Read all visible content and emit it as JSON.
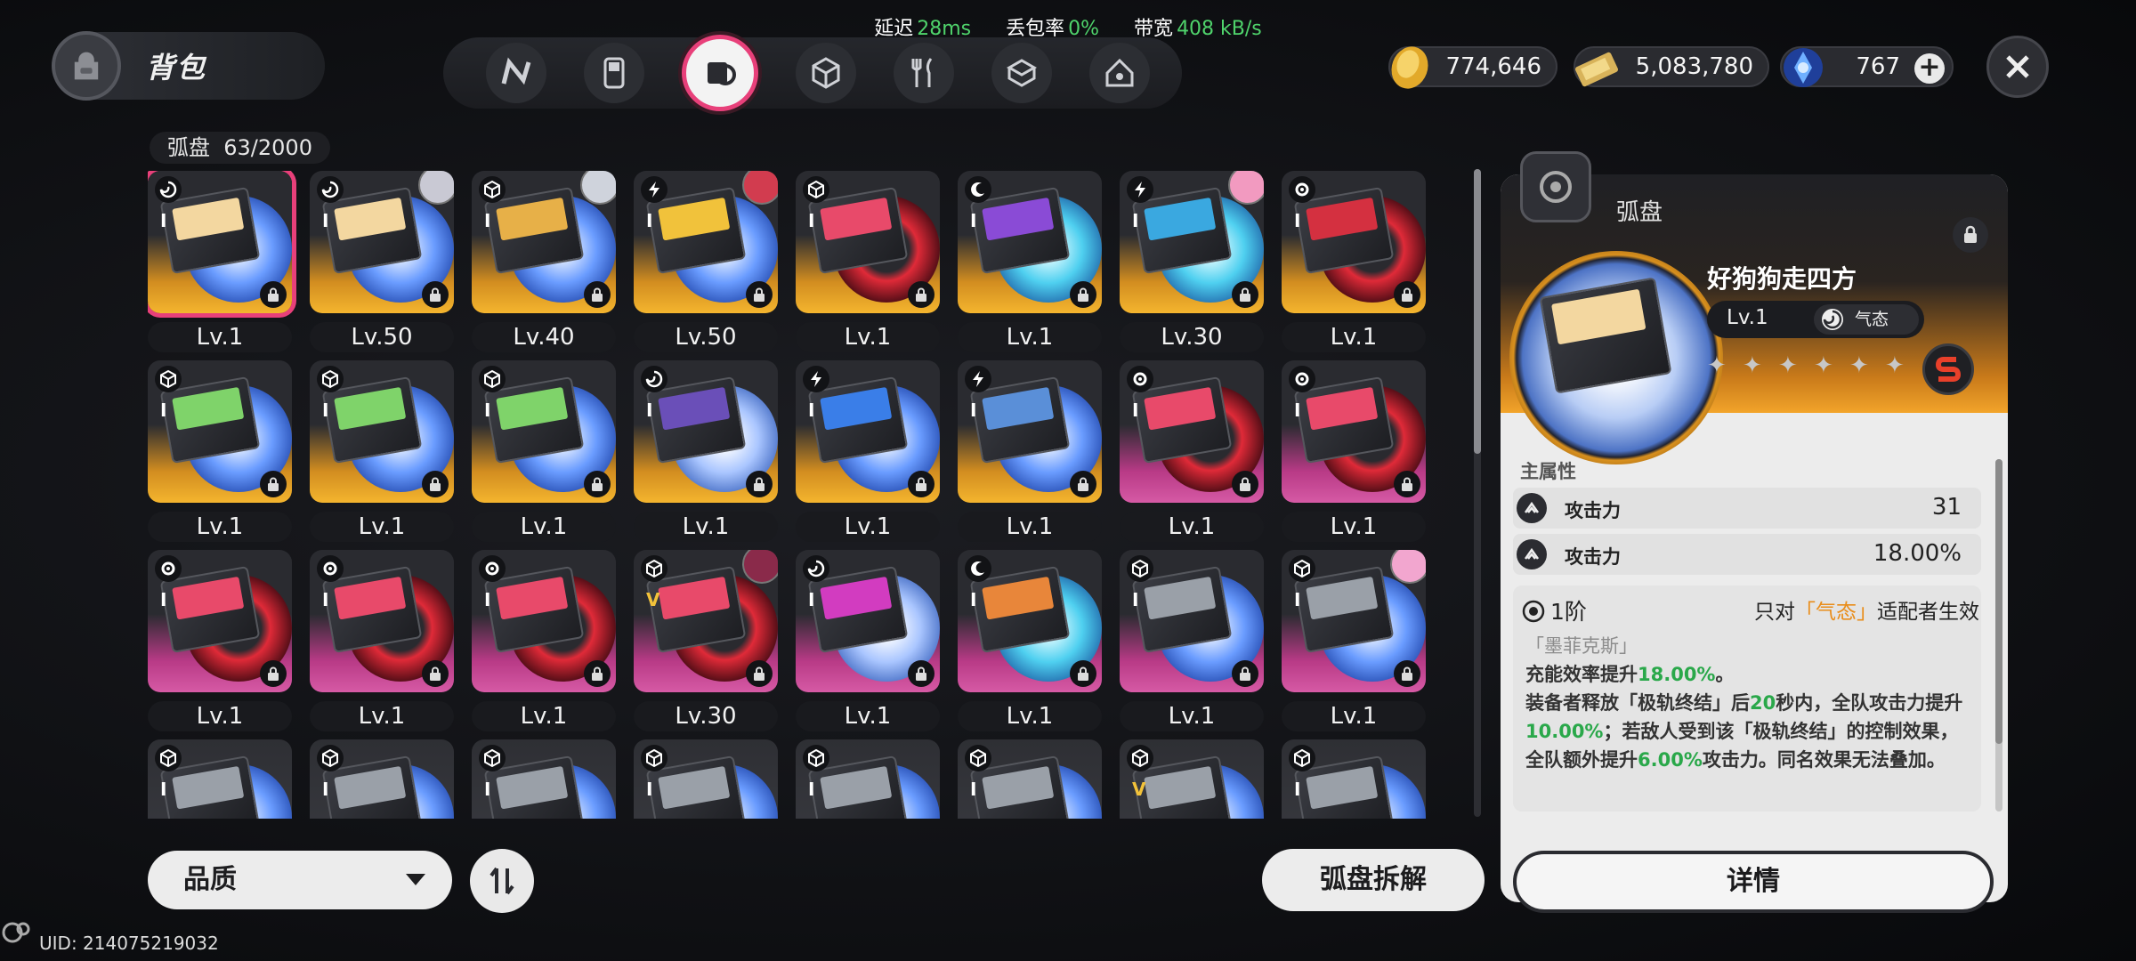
{
  "net": {
    "latency_label": "延迟",
    "latency_value": "28ms",
    "loss_label": "丢包率",
    "loss_value": "0%",
    "bw_label": "带宽",
    "bw_value": "408 kB/s"
  },
  "header": {
    "title": "背包"
  },
  "category_tabs": [
    "n-logo-icon",
    "handheld-icon",
    "disc-icon",
    "cube-icon",
    "fork-knife-icon",
    "package-icon",
    "home-icon"
  ],
  "active_category": 2,
  "currency": {
    "gold": "774,646",
    "ticket": "5,083,780",
    "crystal": "767"
  },
  "list": {
    "title": "弧盘",
    "count": "63/2000"
  },
  "grid": [
    {
      "level": "Lv.1",
      "rank": "I",
      "frame": "gold",
      "disc": "blue",
      "label_color": "#f3d7a0",
      "element": "swirl",
      "selected": true
    },
    {
      "level": "Lv.50",
      "rank": "I",
      "frame": "gold",
      "disc": "blue",
      "label_color": "#f3d7a0",
      "element": "swirl",
      "avatar": "#c9c9d4"
    },
    {
      "level": "Lv.40",
      "rank": "I",
      "frame": "gold",
      "disc": "blue",
      "label_color": "#e7b048",
      "element": "cube",
      "avatar": "#cfd3dc"
    },
    {
      "level": "Lv.50",
      "rank": "I",
      "frame": "gold",
      "disc": "blue",
      "label_color": "#f1c23b",
      "element": "bolt",
      "avatar": "#d23c4f"
    },
    {
      "level": "Lv.1",
      "rank": "I",
      "frame": "gold",
      "disc": "red",
      "label_color": "#e84a6a",
      "element": "cube"
    },
    {
      "level": "Lv.1",
      "rank": "I",
      "frame": "gold",
      "disc": "cyan",
      "label_color": "#8a4bd6",
      "element": "moon"
    },
    {
      "level": "Lv.30",
      "rank": "I",
      "frame": "gold",
      "disc": "cyan",
      "label_color": "#3aa8e0",
      "element": "bolt",
      "avatar": "#f29ac0"
    },
    {
      "level": "Lv.1",
      "rank": "I",
      "frame": "gold",
      "disc": "red",
      "label_color": "#d43040",
      "element": "gear"
    },
    {
      "level": "Lv.1",
      "rank": "I",
      "frame": "gold",
      "disc": "blue",
      "label_color": "#7fd36a",
      "element": "cube"
    },
    {
      "level": "Lv.1",
      "rank": "I",
      "frame": "gold",
      "disc": "blue",
      "label_color": "#7fd36a",
      "element": "cube"
    },
    {
      "level": "Lv.1",
      "rank": "I",
      "frame": "gold",
      "disc": "blue",
      "label_color": "#7fd36a",
      "element": "cube"
    },
    {
      "level": "Lv.1",
      "rank": "I",
      "frame": "gold",
      "disc": "lblue",
      "label_color": "#6a4fb8",
      "element": "swirl"
    },
    {
      "level": "Lv.1",
      "rank": "I",
      "frame": "gold",
      "disc": "blue",
      "label_color": "#3a7ee8",
      "element": "bolt"
    },
    {
      "level": "Lv.1",
      "rank": "I",
      "frame": "gold",
      "disc": "blue",
      "label_color": "#5a8fd8",
      "element": "bolt"
    },
    {
      "level": "Lv.1",
      "rank": "I",
      "frame": "pink",
      "disc": "red",
      "label_color": "#e84a6a",
      "element": "gear"
    },
    {
      "level": "Lv.1",
      "rank": "I",
      "frame": "pink",
      "disc": "red",
      "label_color": "#e84a6a",
      "element": "gear"
    },
    {
      "level": "Lv.1",
      "rank": "I",
      "frame": "pink",
      "disc": "red",
      "label_color": "#e84a6a",
      "element": "gear"
    },
    {
      "level": "Lv.1",
      "rank": "I",
      "frame": "pink",
      "disc": "red",
      "label_color": "#e84a6a",
      "element": "gear"
    },
    {
      "level": "Lv.1",
      "rank": "I",
      "frame": "pink",
      "disc": "red",
      "label_color": "#e84a6a",
      "element": "gear"
    },
    {
      "level": "Lv.30",
      "rank": "V",
      "frame": "pink",
      "disc": "red",
      "label_color": "#e84a6a",
      "element": "cube",
      "avatar": "#8a2a4a"
    },
    {
      "level": "Lv.1",
      "rank": "I",
      "frame": "pink",
      "disc": "lblue",
      "label_color": "#d23cc0",
      "element": "swirl"
    },
    {
      "level": "Lv.1",
      "rank": "I",
      "frame": "pink",
      "disc": "cyan",
      "label_color": "#e8863a",
      "element": "moon"
    },
    {
      "level": "Lv.1",
      "rank": "I",
      "frame": "pink",
      "disc": "blue",
      "label_color": "#9aa0a8",
      "element": "cube"
    },
    {
      "level": "Lv.1",
      "rank": "I",
      "frame": "pink",
      "disc": "blue",
      "label_color": "#9aa0a8",
      "element": "cube",
      "avatar": "#f2a6cf"
    },
    {
      "level": "",
      "rank": "I",
      "frame": "gray",
      "disc": "blue",
      "label_color": "#9aa0a8",
      "element": "cube"
    },
    {
      "level": "",
      "rank": "I",
      "frame": "gray",
      "disc": "blue",
      "label_color": "#9aa0a8",
      "element": "cube"
    },
    {
      "level": "",
      "rank": "I",
      "frame": "gray",
      "disc": "blue",
      "label_color": "#9aa0a8",
      "element": "cube"
    },
    {
      "level": "",
      "rank": "I",
      "frame": "gray",
      "disc": "blue",
      "label_color": "#9aa0a8",
      "element": "cube"
    },
    {
      "level": "",
      "rank": "I",
      "frame": "gray",
      "disc": "blue",
      "label_color": "#9aa0a8",
      "element": "cube"
    },
    {
      "level": "",
      "rank": "I",
      "frame": "gray",
      "disc": "blue",
      "label_color": "#9aa0a8",
      "element": "cube"
    },
    {
      "level": "",
      "rank": "V",
      "frame": "gray",
      "disc": "blue",
      "label_color": "#9aa0a8",
      "element": "cube"
    },
    {
      "level": "",
      "rank": "I",
      "frame": "gray",
      "disc": "blue",
      "label_color": "#9aa0a8",
      "element": "cube"
    }
  ],
  "controls": {
    "sort_label": "品质",
    "dismantle_label": "弧盘拆解",
    "uid": "UID: 214075219032"
  },
  "detail": {
    "title": "弧盘",
    "name": "好狗狗走四方",
    "level": "Lv.1",
    "element": "气态",
    "stars": [
      "✦",
      "✦",
      "✦",
      "✦",
      "✦",
      "✦"
    ],
    "main_attr_label": "主属性",
    "stats": [
      {
        "name": "攻击力",
        "value": "31"
      },
      {
        "name": "攻击力",
        "value": "18.00%"
      }
    ],
    "tier": "1阶",
    "only_prefix": "只对",
    "only_highlight": "「气态」",
    "only_suffix": "适配者生效",
    "set_name": "「墨菲克斯」",
    "desc_1a": "充能效率提升",
    "desc_1b": "18.00%",
    "desc_1c": "。",
    "desc_2a": "装备者释放「极轨终结」后",
    "desc_2b": "20",
    "desc_2c": "秒内，全队攻击力提升",
    "desc_2d": "10.00%",
    "desc_2e": "；若敌人受到该「极轨终结」的控制效果，全队额外提升",
    "desc_2f": "6.00%",
    "desc_2g": "攻击力。同名效果无法叠加。",
    "details_label": "详情"
  },
  "colors": {
    "accent": "#e8407a",
    "green": "#4fd36b",
    "highlight": "#e98d1a"
  }
}
